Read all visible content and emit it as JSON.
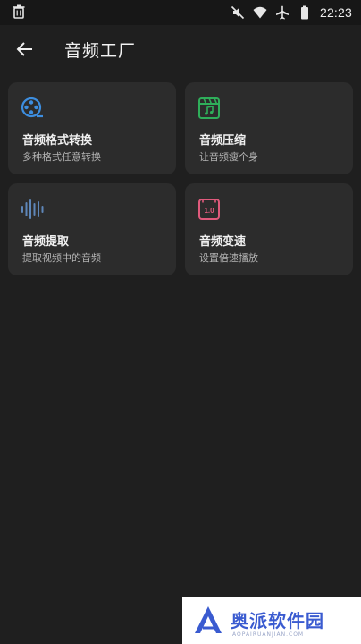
{
  "status_bar": {
    "time": "22:23",
    "left_icon": "trash-icon",
    "right_icons": [
      "mute-icon",
      "wifi-icon",
      "airplane-icon",
      "battery-icon"
    ]
  },
  "app_bar": {
    "title": "音频工厂",
    "back_icon": "arrow-left-icon"
  },
  "tools": [
    {
      "title": "音频格式转换",
      "desc": "多种格式任意转换",
      "icon": "film-reel-icon",
      "color": "#3d8ee0"
    },
    {
      "title": "音频压缩",
      "desc": "让音频瘦个身",
      "icon": "music-clapper-icon",
      "color": "#2fae5a"
    },
    {
      "title": "音频提取",
      "desc": "提取视频中的音频",
      "icon": "waveform-icon",
      "color": "#5e86b8"
    },
    {
      "title": "音频变速",
      "desc": "设置倍速播放",
      "icon": "speed-1x-icon",
      "color": "#e05a7c",
      "speed_label": "1.0"
    }
  ],
  "watermark": {
    "text": "奥派软件园",
    "subtext": "AOPAIRUANJIAN.COM"
  },
  "colors": {
    "background": "#1f1f1f",
    "card": "#2c2c2c",
    "watermark_blue": "#3a5bd0"
  }
}
